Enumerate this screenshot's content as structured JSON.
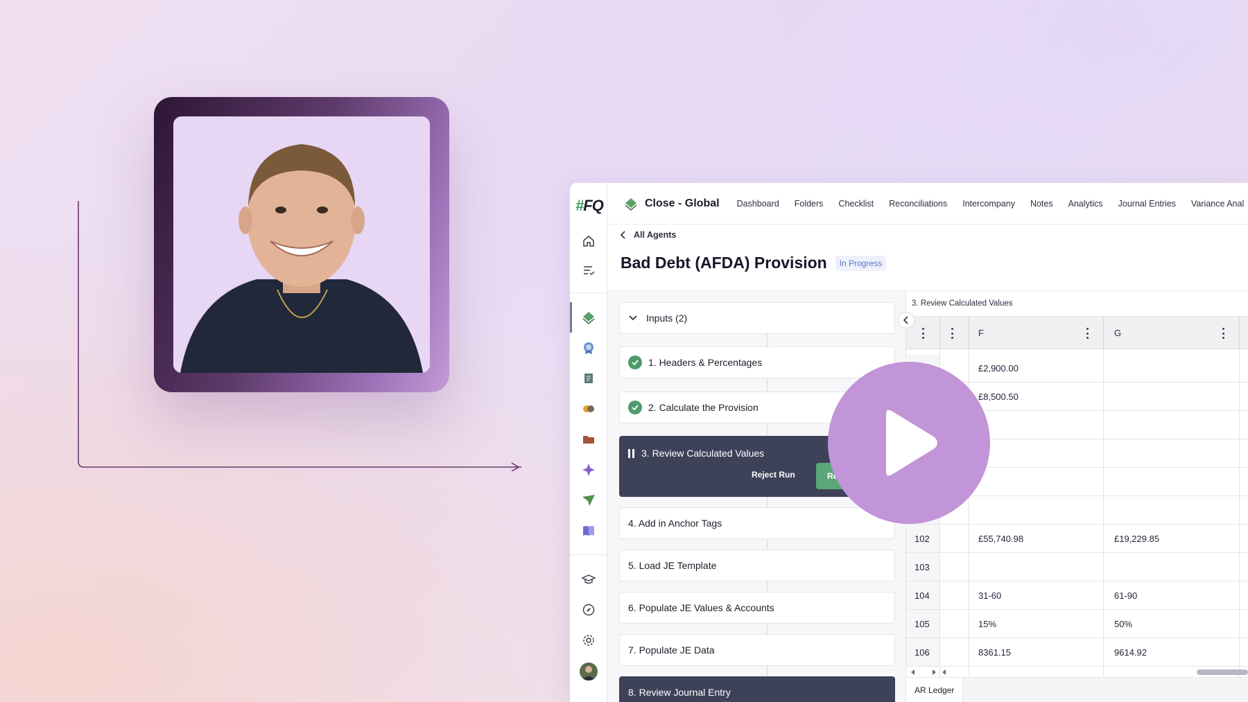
{
  "app": {
    "logo": "#FQ",
    "workspace_title": "Close - Global",
    "nav": [
      "Dashboard",
      "Folders",
      "Checklist",
      "Reconciliations",
      "Intercompany",
      "Notes",
      "Analytics",
      "Journal Entries",
      "Variance Anal"
    ],
    "back_label": "All Agents",
    "page_title": "Bad Debt (AFDA) Provision",
    "status_badge": "In Progress"
  },
  "steps": {
    "inputs_label": "Inputs (2)",
    "items": [
      {
        "label": "1. Headers & Percentages",
        "state": "done"
      },
      {
        "label": "2. Calculate the Provision",
        "state": "done"
      },
      {
        "label": "3. Review Calculated Values",
        "state": "paused"
      },
      {
        "label": "4. Add in Anchor Tags",
        "state": "pending"
      },
      {
        "label": "5. Load JE Template",
        "state": "pending"
      },
      {
        "label": "6. Populate JE Values & Accounts",
        "state": "pending"
      },
      {
        "label": "7. Populate JE Data",
        "state": "pending"
      },
      {
        "label": "8. Review Journal Entry",
        "state": "pending-dark"
      }
    ],
    "reject_label": "Reject Run",
    "run_label": "Re"
  },
  "sheet": {
    "title": "3. Review Calculated Values",
    "columns": [
      "F",
      "G"
    ],
    "rows": [
      {
        "num": "",
        "f": "£2,900.00",
        "g": ""
      },
      {
        "num": "",
        "f": "£8,500.50",
        "g": ""
      },
      {
        "num": "",
        "f": "",
        "g": ""
      },
      {
        "num": "",
        "f": "",
        "g": ""
      },
      {
        "num": "",
        "f": "",
        "g": ""
      },
      {
        "num": "",
        "f": "",
        "g": ""
      },
      {
        "num": "102",
        "f": "£55,740.98",
        "g": "£19,229.85"
      },
      {
        "num": "103",
        "f": "",
        "g": ""
      },
      {
        "num": "104",
        "f": "31-60",
        "g": "61-90"
      },
      {
        "num": "105",
        "f": "15%",
        "g": "50%"
      },
      {
        "num": "106",
        "f": "8361.15",
        "g": "9614.92"
      }
    ],
    "tab_label": "AR Ledger"
  },
  "colors": {
    "accent_green": "#4f9a6a",
    "dark_step": "#3d4259",
    "play_button": "#c294d8",
    "badge_text": "#5a78c6"
  }
}
